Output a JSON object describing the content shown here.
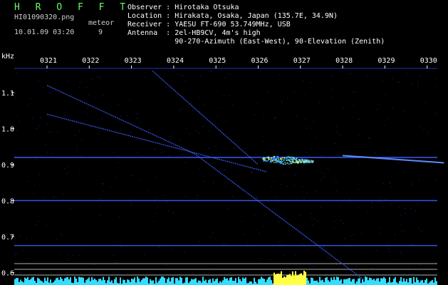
{
  "header": {
    "app_name": "H R O F F T",
    "filename": "HI01090320.png",
    "datetime": "10.01.09 03:20",
    "meteor_label": "meteor",
    "meteor_count": "9",
    "observer": "Observer : Hirotaka Otsuka",
    "location": "Location : Hirakata, Osaka, Japan (135.7E, 34.9N)",
    "receiver": "Receiver : YAESU FT-690 53.749MHz, USB",
    "antenna": "Antenna  : 2el-HB9CV, 4m's high",
    "antenna2": "           90-270-Azimuth (East-West), 90-Elevation (Zenith)"
  },
  "colors": {
    "background": "#000000",
    "text": "#ffffff",
    "title": "#66ff66",
    "trace": "#3d5cff",
    "echo": "#ffff44",
    "noise": "#33ddff"
  },
  "chart_data": {
    "type": "heatmap",
    "ylabel": "kHz",
    "x_ticks": [
      "0321",
      "0322",
      "0323",
      "0324",
      "0325",
      "0326",
      "0327",
      "0328",
      "0329",
      "0330"
    ],
    "y_ticks": [
      "1.1",
      "1.0",
      "0.9",
      "0.8",
      "0.7",
      "0.6"
    ],
    "xlim": [
      0,
      10
    ],
    "ylim": [
      0.58,
      1.17
    ],
    "carrier_lines_khz": [
      0.92,
      0.8,
      0.675
    ],
    "drift_traces": [
      {
        "points": [
          [
            0,
            1.12
          ],
          [
            3.5,
            0.93
          ],
          [
            7.5,
            0.58
          ]
        ]
      },
      {
        "points": [
          [
            0,
            1.04
          ],
          [
            5.2,
            0.88
          ]
        ]
      },
      {
        "points": [
          [
            2.5,
            1.16
          ],
          [
            5.0,
            0.9
          ]
        ]
      }
    ],
    "echo": {
      "x": 5.6,
      "y_khz": 0.91,
      "x_span": [
        5.1,
        6.3
      ]
    },
    "ping_trace": {
      "points": [
        [
          7.0,
          0.925
        ],
        [
          9.4,
          0.905
        ]
      ]
    }
  }
}
